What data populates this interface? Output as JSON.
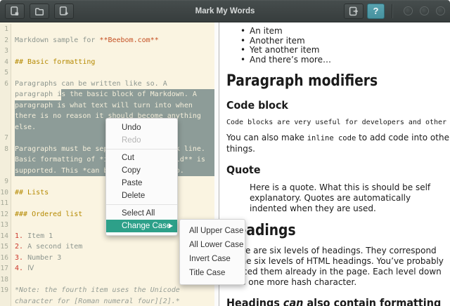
{
  "colors": {
    "titlebar_bg": "#3d4444",
    "help_button_teal": "#4b96a3",
    "editor_bg": "#faf4e1",
    "gutter_bg": "#f3eedb",
    "editor_text": "#8d968f",
    "selection_bg": "#8d9c98",
    "heading_yellow": "#b58900",
    "markup_orange": "#c44f22",
    "list_number_red": "#cc392d",
    "menu_accent_teal": "#2da089"
  },
  "titlebar": {
    "title": "Mark My Words",
    "help_glyph": "?"
  },
  "toolbar": {
    "left_buttons": [
      "new-document",
      "open-document",
      "add-document"
    ],
    "right_buttons": [
      "export-document",
      "help"
    ],
    "window_controls": [
      "minimize",
      "maximize",
      "close"
    ]
  },
  "editor": {
    "rows": [
      {
        "num": "1"
      },
      {
        "num": "2",
        "segs": [
          {
            "t": "Markdown sample for ",
            "c": "txt"
          },
          {
            "t": "**Beebom.com**",
            "c": "orange"
          }
        ]
      },
      {
        "num": "3"
      },
      {
        "num": "4",
        "segs": [
          {
            "t": "## Basic formatting",
            "c": "yellow"
          }
        ]
      },
      {
        "num": "5"
      },
      {
        "num": "6",
        "segs": [
          {
            "t": "Paragraphs can be written like so. A",
            "c": "txt"
          }
        ]
      },
      {
        "segs": [
          {
            "t": "paragraph i",
            "c": "txt"
          },
          {
            "t": "s the basic block of Markdown. A",
            "c": "sel"
          }
        ],
        "fill": true
      },
      {
        "segs": [
          {
            "t": "paragraph is what text will turn into when",
            "c": "sel"
          }
        ],
        "fill": true
      },
      {
        "segs": [
          {
            "t": "there is no reason it should become anything",
            "c": "sel"
          }
        ],
        "fill": true
      },
      {
        "segs": [
          {
            "t": "else.",
            "c": "sel"
          }
        ],
        "fill": true
      },
      {
        "num": "7",
        "fill": true
      },
      {
        "num": "8",
        "segs": [
          {
            "t": "Paragraphs must be separated by a blank line.",
            "c": "sel"
          }
        ],
        "fill": true
      },
      {
        "segs": [
          {
            "t": "Basic formatting of *italics* and **bold** is",
            "c": "sel"
          }
        ],
        "fill": true
      },
      {
        "segs": [
          {
            "t": "supported. This *can be nested like* so.",
            "c": "sel"
          }
        ],
        "fill": true
      },
      {
        "num": "9"
      },
      {
        "num": "10",
        "segs": [
          {
            "t": "## Lists",
            "c": "yellow"
          }
        ]
      },
      {
        "num": "11"
      },
      {
        "num": "12",
        "segs": [
          {
            "t": "### Ordered list",
            "c": "yellow"
          }
        ]
      },
      {
        "num": "13"
      },
      {
        "num": "14",
        "segs": [
          {
            "t": "1. ",
            "c": "red"
          },
          {
            "t": "Item 1",
            "c": "txt"
          }
        ]
      },
      {
        "num": "15",
        "segs": [
          {
            "t": "2. ",
            "c": "red"
          },
          {
            "t": "A second item",
            "c": "txt"
          }
        ]
      },
      {
        "num": "16",
        "segs": [
          {
            "t": "3. ",
            "c": "red"
          },
          {
            "t": "Number 3",
            "c": "txt"
          }
        ]
      },
      {
        "num": "17",
        "segs": [
          {
            "t": "4. ",
            "c": "red"
          },
          {
            "t": "Ⅳ",
            "c": "txt"
          }
        ]
      },
      {
        "num": "18"
      },
      {
        "num": "19",
        "segs": [
          {
            "t": "*Note: the fourth item uses the Unicode",
            "c": "italic"
          }
        ]
      },
      {
        "segs": [
          {
            "t": "character for [Roman numeral four][2].*",
            "c": "italic"
          }
        ]
      }
    ]
  },
  "context_menu": {
    "items": [
      {
        "label": "Undo"
      },
      {
        "label": "Redo",
        "disabled": true
      },
      {
        "type": "separator"
      },
      {
        "label": "Cut"
      },
      {
        "label": "Copy"
      },
      {
        "label": "Paste"
      },
      {
        "label": "Delete"
      },
      {
        "type": "separator"
      },
      {
        "label": "Select All"
      },
      {
        "label": "Change Case",
        "highlighted": true,
        "has_submenu": true
      }
    ]
  },
  "submenu": {
    "items": [
      "All Upper Case",
      "All Lower Case",
      "Invert Case",
      "Title Case"
    ]
  },
  "preview": {
    "blocks": [
      {
        "type": "ul",
        "items": [
          "An item",
          "Another item",
          "Yet another item",
          "And there’s more…"
        ]
      },
      {
        "type": "h1",
        "segs": [
          {
            "t": "Paragraph modifiers"
          }
        ]
      },
      {
        "type": "h3",
        "segs": [
          {
            "t": "Code block"
          }
        ]
      },
      {
        "type": "code",
        "text": "Code blocks are very useful for developers and other people who look at code."
      },
      {
        "type": "p",
        "segs": [
          {
            "t": "You can also make "
          },
          {
            "t": "inline code",
            "m": true
          },
          {
            "t": " to add code into other",
            "br": true
          },
          {
            "t": "things."
          }
        ]
      },
      {
        "type": "h3",
        "segs": [
          {
            "t": "Quote"
          }
        ]
      },
      {
        "type": "quote",
        "segs": [
          {
            "t": "Here is a quote. What this is should be self",
            "br": true
          },
          {
            "t": "explanatory. Quotes are automatically",
            "br": true
          },
          {
            "t": "indented when they are used."
          }
        ]
      },
      {
        "type": "h1",
        "segs": [
          {
            "t": "Headings"
          }
        ]
      },
      {
        "type": "p",
        "segs": [
          {
            "t": "There are six levels of headings. They correspond",
            "br": true
          },
          {
            "t": "to the six levels of HTML headings. You’ve probably",
            "br": true
          },
          {
            "t": "noticed them already in the page. Each level down",
            "br": true
          },
          {
            "t": "uses one more hash character."
          }
        ]
      },
      {
        "type": "h2",
        "segs": [
          {
            "t": "Headings "
          },
          {
            "t": "can",
            "i": true
          },
          {
            "t": " also contain formatting"
          }
        ]
      }
    ]
  }
}
